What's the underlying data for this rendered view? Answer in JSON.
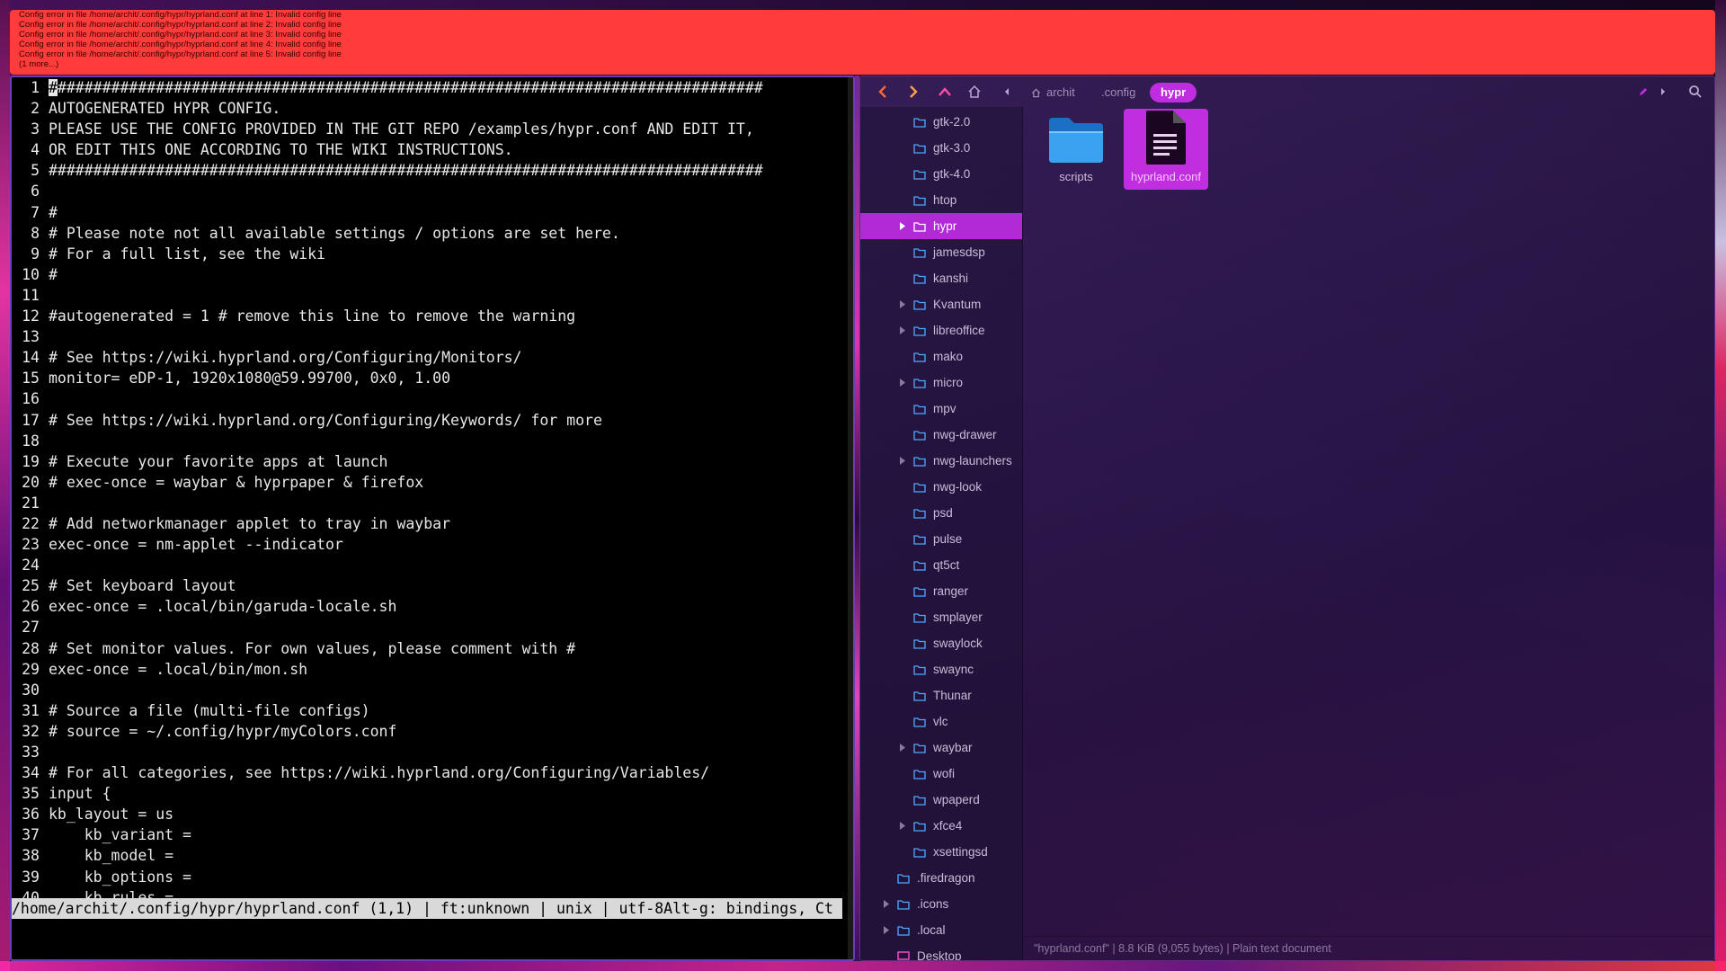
{
  "error_bar": {
    "lines": [
      "Config error in file /home/archit/.config/hypr/hyprland.conf at line 1: Invalid config line",
      "Config error in file /home/archit/.config/hypr/hyprland.conf at line 2: Invalid config line",
      "Config error in file /home/archit/.config/hypr/hyprland.conf at line 3: Invalid config line",
      "Config error in file /home/archit/.config/hypr/hyprland.conf at line 4: Invalid config line",
      "Config error in file /home/archit/.config/hypr/hyprland.conf at line 5: Invalid config line",
      "(1 more...)"
    ],
    "color": "#ff3b3b"
  },
  "editor": {
    "lines": [
      {
        "n": "1",
        "t": "################################################################################"
      },
      {
        "n": "2",
        "t": "AUTOGENERATED HYPR CONFIG."
      },
      {
        "n": "3",
        "t": "PLEASE USE THE CONFIG PROVIDED IN THE GIT REPO /examples/hypr.conf AND EDIT IT,"
      },
      {
        "n": "4",
        "t": "OR EDIT THIS ONE ACCORDING TO THE WIKI INSTRUCTIONS."
      },
      {
        "n": "5",
        "t": "################################################################################"
      },
      {
        "n": "6",
        "t": ""
      },
      {
        "n": "7",
        "t": "#"
      },
      {
        "n": "8",
        "t": "# Please note not all available settings / options are set here."
      },
      {
        "n": "9",
        "t": "# For a full list, see the wiki"
      },
      {
        "n": "10",
        "t": "#"
      },
      {
        "n": "11",
        "t": ""
      },
      {
        "n": "12",
        "t": "#autogenerated = 1 # remove this line to remove the warning"
      },
      {
        "n": "13",
        "t": ""
      },
      {
        "n": "14",
        "t": "# See https://wiki.hyprland.org/Configuring/Monitors/"
      },
      {
        "n": "15",
        "t": "monitor= eDP-1, 1920x1080@59.99700, 0x0, 1.00"
      },
      {
        "n": "16",
        "t": ""
      },
      {
        "n": "17",
        "t": "# See https://wiki.hyprland.org/Configuring/Keywords/ for more"
      },
      {
        "n": "18",
        "t": ""
      },
      {
        "n": "19",
        "t": "# Execute your favorite apps at launch"
      },
      {
        "n": "20",
        "t": "# exec-once = waybar & hyprpaper & firefox"
      },
      {
        "n": "21",
        "t": ""
      },
      {
        "n": "22",
        "t": "# Add networkmanager applet to tray in waybar"
      },
      {
        "n": "23",
        "t": "exec-once = nm-applet --indicator"
      },
      {
        "n": "24",
        "t": ""
      },
      {
        "n": "25",
        "t": "# Set keyboard layout"
      },
      {
        "n": "26",
        "t": "exec-once = .local/bin/garuda-locale.sh"
      },
      {
        "n": "27",
        "t": ""
      },
      {
        "n": "28",
        "t": "# Set monitor values. For own values, please comment with #"
      },
      {
        "n": "29",
        "t": "exec-once = .local/bin/mon.sh"
      },
      {
        "n": "30",
        "t": ""
      },
      {
        "n": "31",
        "t": "# Source a file (multi-file configs)"
      },
      {
        "n": "32",
        "t": "# source = ~/.config/hypr/myColors.conf"
      },
      {
        "n": "33",
        "t": ""
      },
      {
        "n": "34",
        "t": "# For all categories, see https://wiki.hyprland.org/Configuring/Variables/"
      },
      {
        "n": "35",
        "t": "input {"
      },
      {
        "n": "36",
        "t": "kb_layout = us"
      },
      {
        "n": "37",
        "t": "    kb_variant ="
      },
      {
        "n": "38",
        "t": "    kb_model ="
      },
      {
        "n": "39",
        "t": "    kb_options ="
      },
      {
        "n": "40",
        "t": "    kb_rules ="
      }
    ],
    "statusline": "/home/archit/.config/hypr/hyprland.conf (1,1) | ft:unknown | unix | utf-8Alt-g: bindings, Ct"
  },
  "filemanager": {
    "breadcrumbs": [
      {
        "label": "archit",
        "icon": "home-icon"
      },
      {
        "label": ".config"
      },
      {
        "label": "hypr",
        "active": true
      }
    ],
    "sidebar_items": [
      {
        "label": "gtk-2.0",
        "expandable": false,
        "level": 1
      },
      {
        "label": "gtk-3.0",
        "expandable": false,
        "level": 1
      },
      {
        "label": "gtk-4.0",
        "expandable": false,
        "level": 1
      },
      {
        "label": "htop",
        "expandable": false,
        "level": 1
      },
      {
        "label": "hypr",
        "expandable": true,
        "level": 1,
        "selected": true
      },
      {
        "label": "jamesdsp",
        "expandable": false,
        "level": 1
      },
      {
        "label": "kanshi",
        "expandable": false,
        "level": 1
      },
      {
        "label": "Kvantum",
        "expandable": true,
        "level": 1
      },
      {
        "label": "libreoffice",
        "expandable": true,
        "level": 1
      },
      {
        "label": "mako",
        "expandable": false,
        "level": 1
      },
      {
        "label": "micro",
        "expandable": true,
        "level": 1
      },
      {
        "label": "mpv",
        "expandable": false,
        "level": 1
      },
      {
        "label": "nwg-drawer",
        "expandable": false,
        "level": 1
      },
      {
        "label": "nwg-launchers",
        "expandable": true,
        "level": 1
      },
      {
        "label": "nwg-look",
        "expandable": false,
        "level": 1
      },
      {
        "label": "psd",
        "expandable": false,
        "level": 1
      },
      {
        "label": "pulse",
        "expandable": false,
        "level": 1
      },
      {
        "label": "qt5ct",
        "expandable": false,
        "level": 1
      },
      {
        "label": "ranger",
        "expandable": false,
        "level": 1
      },
      {
        "label": "smplayer",
        "expandable": false,
        "level": 1
      },
      {
        "label": "swaylock",
        "expandable": false,
        "level": 1
      },
      {
        "label": "swaync",
        "expandable": false,
        "level": 1
      },
      {
        "label": "Thunar",
        "expandable": false,
        "level": 1
      },
      {
        "label": "vlc",
        "expandable": false,
        "level": 1
      },
      {
        "label": "waybar",
        "expandable": true,
        "level": 1
      },
      {
        "label": "wofi",
        "expandable": false,
        "level": 1
      },
      {
        "label": "wpaperd",
        "expandable": false,
        "level": 1
      },
      {
        "label": "xfce4",
        "expandable": true,
        "level": 1
      },
      {
        "label": "xsettingsd",
        "expandable": false,
        "level": 1
      },
      {
        "label": ".firedragon",
        "expandable": false,
        "level": 0
      },
      {
        "label": ".icons",
        "expandable": true,
        "level": 0
      },
      {
        "label": ".local",
        "expandable": true,
        "level": 0
      },
      {
        "label": "Desktop",
        "expandable": false,
        "level": 0,
        "special": true
      }
    ],
    "files": [
      {
        "label": "scripts",
        "type": "folder"
      },
      {
        "label": "hyprland.conf",
        "type": "text",
        "selected": true
      }
    ],
    "status": "\"hyprland.conf\" | 8.8 KiB (9,055 bytes) | Plain text document",
    "accent": "#c12ee0",
    "folder_color": "#3aa2f0"
  }
}
